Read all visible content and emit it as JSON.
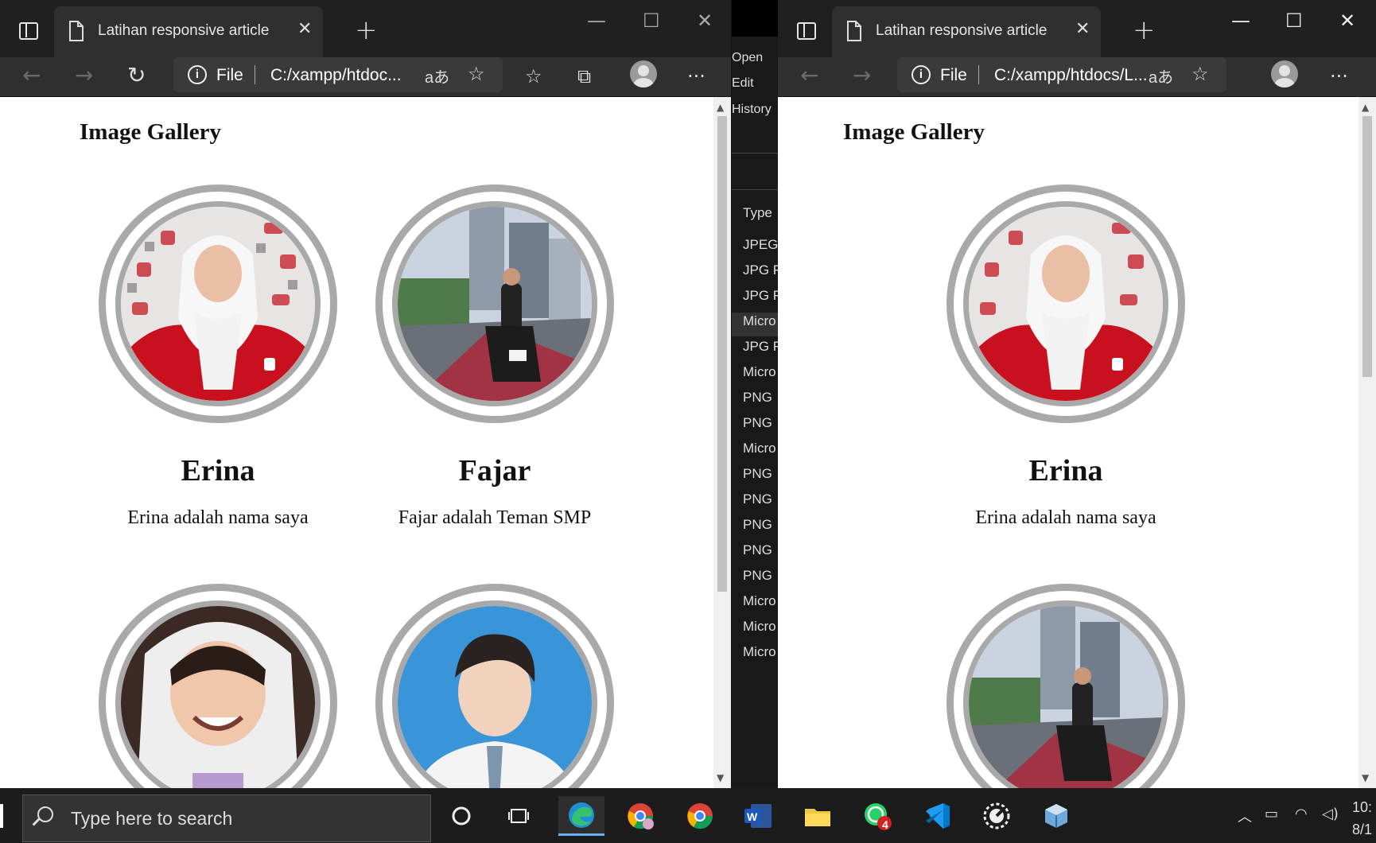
{
  "left_window": {
    "tab_title": "Latihan responsive article",
    "address": {
      "scheme_label": "File",
      "url": "C:/xampp/htdoc..."
    },
    "page": {
      "heading": "Image Gallery",
      "cards": [
        {
          "name": "Erina",
          "desc": "Erina adalah nama saya"
        },
        {
          "name": "Fajar",
          "desc": "Fajar adalah Teman SMP"
        },
        {
          "name": "",
          "desc": ""
        },
        {
          "name": "",
          "desc": ""
        }
      ]
    }
  },
  "right_window": {
    "tab_title": "Latihan responsive article",
    "address": {
      "scheme_label": "File",
      "url": "C:/xampp/htdocs/L..."
    },
    "page": {
      "heading": "Image Gallery",
      "cards": [
        {
          "name": "Erina",
          "desc": "Erina adalah nama saya"
        },
        {
          "name": "",
          "desc": ""
        }
      ]
    }
  },
  "explorer_strip": {
    "menu": [
      "Open",
      "Edit",
      "History"
    ],
    "column_header": "Type",
    "rows": [
      "JPEG",
      "JPG F",
      "JPG F",
      "Micro",
      "JPG F",
      "Micro",
      "PNG",
      "PNG",
      "Micro",
      "PNG",
      "PNG",
      "PNG",
      "PNG",
      "PNG",
      "Micro",
      "Micro",
      "Micro"
    ]
  },
  "taskbar": {
    "search_placeholder": "Type here to search",
    "whatsapp_badge": "4",
    "clock_time": "10:",
    "clock_date": "8/1"
  },
  "colors": {
    "ring": "#a9a9a9",
    "chrome_dark": "#202020",
    "tab_bg": "#2f2f2f",
    "taskbar_bg": "#1c1c1c",
    "edge_accent": "#6ab0f2"
  }
}
